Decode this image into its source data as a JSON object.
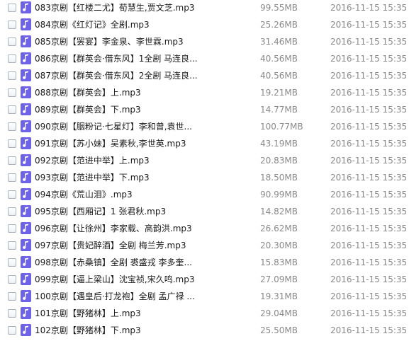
{
  "colors": {
    "icon_background": "#6e63e6",
    "text": "#1a1a1a",
    "meta_text": "#8a8a8a",
    "checkbox_border": "#a9b1bb"
  },
  "file_icon": "music-note-icon",
  "files": [
    {
      "name": "083京剧【红楼二尤】荀慧生,贾文芝.mp3",
      "size": "99.55MB",
      "modified": "2016-11-15 15:35"
    },
    {
      "name": "084京剧《红灯记》全剧.mp3",
      "size": "25.26MB",
      "modified": "2016-11-15 15:35"
    },
    {
      "name": "085京剧【罢宴】李金泉、李世霖.mp3",
      "size": "31.46MB",
      "modified": "2016-11-15 15:35"
    },
    {
      "name": "086京剧【群英会·借东风】1全剧 马连良...",
      "size": "40.56MB",
      "modified": "2016-11-15 15:35"
    },
    {
      "name": "087京剧【群英会·借东风】2全剧 马连良...",
      "size": "40.56MB",
      "modified": "2016-11-15 15:35"
    },
    {
      "name": "088京剧【群英会】上.mp3",
      "size": "19.21MB",
      "modified": "2016-11-15 15:35"
    },
    {
      "name": "089京剧【群英会】下.mp3",
      "size": "14.77MB",
      "modified": "2016-11-15 15:35"
    },
    {
      "name": "090京剧【胭粉记·七星灯】李和曾,袁世...",
      "size": "100.77MB",
      "modified": "2016-11-15 15:35"
    },
    {
      "name": "091京剧【苏小妹】吴素秋,李世英.mp3",
      "size": "43.19MB",
      "modified": "2016-11-15 15:35"
    },
    {
      "name": "092京剧【范进中举】上.mp3",
      "size": "20.83MB",
      "modified": "2016-11-15 15:35"
    },
    {
      "name": "093京剧【范进中举】下.mp3",
      "size": "18.50MB",
      "modified": "2016-11-15 15:35"
    },
    {
      "name": "094京剧《荒山泪》.mp3",
      "size": "90.99MB",
      "modified": "2016-11-15 15:35"
    },
    {
      "name": "095京剧【西厢记】1 张君秋.mp3",
      "size": "14.82MB",
      "modified": "2016-11-15 15:35"
    },
    {
      "name": "096京剧【让徐州】李家载、高韵洪.mp3",
      "size": "26.62MB",
      "modified": "2016-11-15 15:35"
    },
    {
      "name": "097京剧【贵妃醉酒】全剧 梅兰芳.mp3",
      "size": "20.30MB",
      "modified": "2016-11-15 15:35"
    },
    {
      "name": "098京剧【赤桑镇】全剧 裘盛戎 李多奎...",
      "size": "15.83MB",
      "modified": "2016-11-15 15:35"
    },
    {
      "name": "099京剧【逼上梁山】沈宝祯,宋久鸣.mp3",
      "size": "27.09MB",
      "modified": "2016-11-15 15:35"
    },
    {
      "name": "100京剧【遇皇后·打龙袍】全剧 孟广禄 ...",
      "size": "19.31MB",
      "modified": "2016-11-15 15:35"
    },
    {
      "name": "101京剧【野猪林】上.mp3",
      "size": "29.04MB",
      "modified": "2016-11-15 15:35"
    },
    {
      "name": "102京剧【野猪林】下.mp3",
      "size": "25.50MB",
      "modified": "2016-11-15 15:35"
    }
  ]
}
